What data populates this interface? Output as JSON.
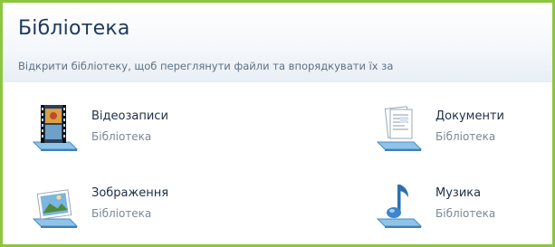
{
  "library": {
    "title": "Бібліотека",
    "description": "Відкрити бібліотеку, щоб переглянути файли та впорядкувати їх за"
  },
  "items": [
    {
      "name": "Відеозаписи",
      "type": "Бібліотека",
      "icon": "video-library-icon"
    },
    {
      "name": "Документи",
      "type": "Бібліотека",
      "icon": "documents-library-icon"
    },
    {
      "name": "Зображення",
      "type": "Бібліотека",
      "icon": "pictures-library-icon"
    },
    {
      "name": "Музика",
      "type": "Бібліотека",
      "icon": "music-library-icon"
    }
  ],
  "colors": {
    "border": "#8cc63f",
    "title": "#1e395b",
    "muted": "#7a8796"
  }
}
